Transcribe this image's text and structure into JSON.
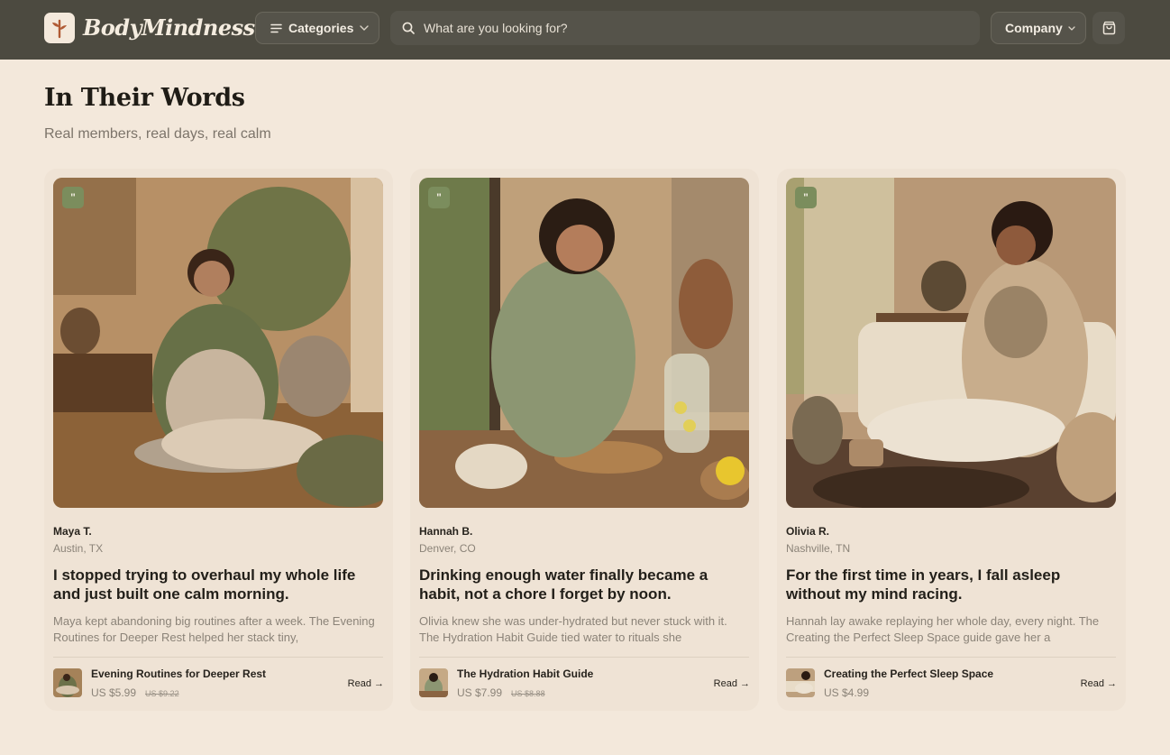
{
  "header": {
    "brand": "BodyMindness",
    "categories_label": "Categories",
    "search_placeholder": "What are you looking for?",
    "company_label": "Company"
  },
  "section": {
    "title": "In Their Words",
    "subtitle": "Real members, real days, real calm"
  },
  "testimonials": [
    {
      "name": "Maya T.",
      "location": "Austin, TX",
      "headline": "I stopped trying to overhaul my whole life and just built one calm morning.",
      "excerpt": "Maya kept abandoning big routines after a week. The Evening Routines for Deeper Rest helped her stack tiny,",
      "guide_title": "Evening Routines for Deeper Rest",
      "price": "US $5.99",
      "old_price": "US $9.22",
      "read_label": "Read →"
    },
    {
      "name": "Hannah B.",
      "location": "Denver, CO",
      "headline": "Drinking enough water finally became a habit, not a chore I forget by noon.",
      "excerpt": "Olivia knew she was under-hydrated but never stuck with it. The Hydration Habit Guide tied water to rituals she",
      "guide_title": "The Hydration Habit Guide",
      "price": "US $7.99",
      "old_price": "US $8.88",
      "read_label": "Read →"
    },
    {
      "name": "Olivia R.",
      "location": "Nashville, TN",
      "headline": "For the first time in years, I fall asleep without my mind racing.",
      "excerpt": "Hannah lay awake replaying her whole day, every night. The Creating the Perfect Sleep Space guide gave her a",
      "guide_title": "Creating the Perfect Sleep Space",
      "price": "US $4.99",
      "old_price": "",
      "read_label": "Read →"
    }
  ],
  "icons": {
    "logo": "sprout-logo-icon",
    "menu": "menu-lines-icon",
    "search": "search-icon",
    "chevron": "chevron-down-icon",
    "cart": "shopping-bag-icon",
    "quote": "quote-icon"
  },
  "colors": {
    "header_bg": "#4c4a40",
    "page_bg": "#f3e8db",
    "card_bg": "#efe3d5",
    "badge": "#7b8d5d",
    "logo_accent": "#b05a34"
  }
}
